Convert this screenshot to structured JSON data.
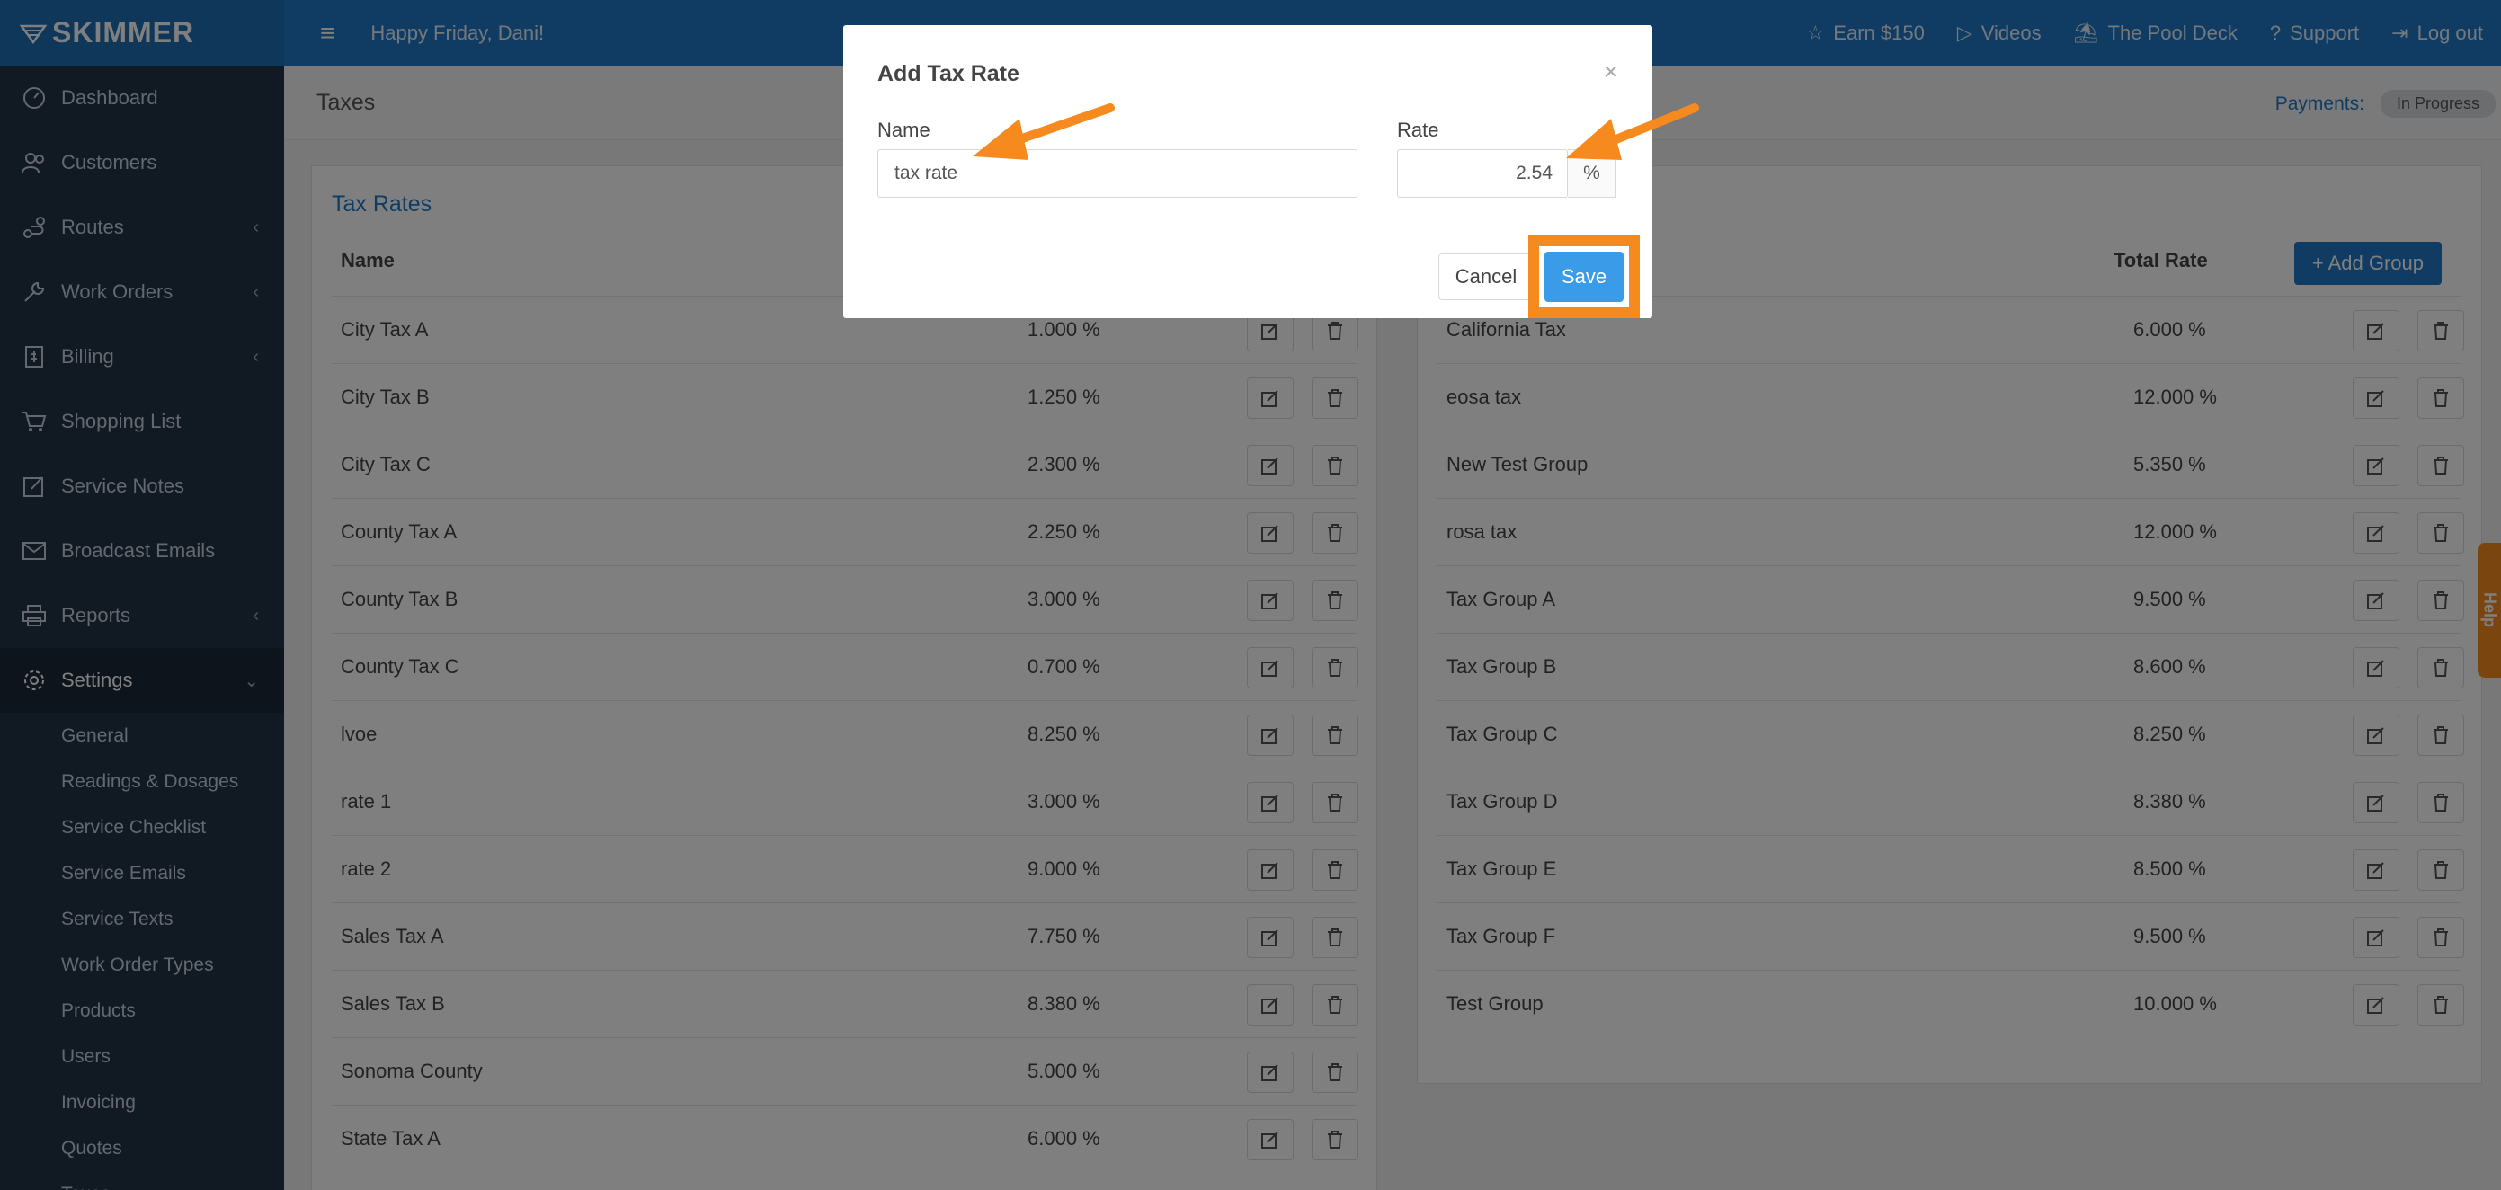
{
  "app": {
    "logo": "SKIMMER"
  },
  "topbar": {
    "greeting": "Happy Friday, Dani!",
    "links": [
      {
        "label": "Earn $150",
        "icon": "star-icon"
      },
      {
        "label": "Videos",
        "icon": "play-icon"
      },
      {
        "label": "The Pool Deck",
        "icon": "pool-icon"
      },
      {
        "label": "Support",
        "icon": "question-icon"
      },
      {
        "label": "Log out",
        "icon": "logout-icon"
      }
    ]
  },
  "sidebar": {
    "items": [
      {
        "label": "Dashboard",
        "icon": "dashboard-icon"
      },
      {
        "label": "Customers",
        "icon": "customers-icon"
      },
      {
        "label": "Routes",
        "icon": "routes-icon"
      },
      {
        "label": "Work Orders",
        "icon": "wrench-icon"
      },
      {
        "label": "Billing",
        "icon": "billing-icon"
      },
      {
        "label": "Shopping List",
        "icon": "cart-icon"
      },
      {
        "label": "Service Notes",
        "icon": "notes-icon"
      },
      {
        "label": "Broadcast Emails",
        "icon": "mail-icon"
      },
      {
        "label": "Reports",
        "icon": "printer-icon"
      },
      {
        "label": "Settings",
        "icon": "gear-icon"
      }
    ],
    "settings_sub": [
      "General",
      "Readings & Dosages",
      "Service Checklist",
      "Service Emails",
      "Service Texts",
      "Work Order Types",
      "Products",
      "Users",
      "Invoicing",
      "Quotes",
      "Taxes"
    ]
  },
  "page": {
    "title": "Taxes",
    "payments_label": "Payments:",
    "payments_status": "In Progress"
  },
  "tax_rates": {
    "title": "Tax Rates",
    "col_name": "Name",
    "rows": [
      {
        "name": "City Tax A",
        "rate": "1.000 %"
      },
      {
        "name": "City Tax B",
        "rate": "1.250 %"
      },
      {
        "name": "City Tax C",
        "rate": "2.300 %"
      },
      {
        "name": "County Tax A",
        "rate": "2.250 %"
      },
      {
        "name": "County Tax B",
        "rate": "3.000 %"
      },
      {
        "name": "County Tax C",
        "rate": "0.700 %"
      },
      {
        "name": "lvoe",
        "rate": "8.250 %"
      },
      {
        "name": "rate 1",
        "rate": "3.000 %"
      },
      {
        "name": "rate 2",
        "rate": "9.000 %"
      },
      {
        "name": "Sales Tax A",
        "rate": "7.750 %"
      },
      {
        "name": "Sales Tax B",
        "rate": "8.380 %"
      },
      {
        "name": "Sonoma County",
        "rate": "5.000 %"
      },
      {
        "name": "State Tax A",
        "rate": "6.000 %"
      }
    ]
  },
  "tax_groups": {
    "col_total": "Total Rate",
    "add_label": "+ Add Group",
    "rows": [
      {
        "name": "California Tax",
        "rate": "6.000 %"
      },
      {
        "name": "eosa tax",
        "rate": "12.000 %"
      },
      {
        "name": "New Test Group",
        "rate": "5.350 %"
      },
      {
        "name": "rosa tax",
        "rate": "12.000 %"
      },
      {
        "name": "Tax Group A",
        "rate": "9.500 %"
      },
      {
        "name": "Tax Group B",
        "rate": "8.600 %"
      },
      {
        "name": "Tax Group C",
        "rate": "8.250 %"
      },
      {
        "name": "Tax Group D",
        "rate": "8.380 %"
      },
      {
        "name": "Tax Group E",
        "rate": "8.500 %"
      },
      {
        "name": "Tax Group F",
        "rate": "9.500 %"
      },
      {
        "name": "Test Group",
        "rate": "10.000 %"
      }
    ]
  },
  "modal": {
    "title": "Add Tax Rate",
    "close": "×",
    "name_label": "Name",
    "name_value": "tax rate",
    "rate_label": "Rate",
    "rate_value": "2.54",
    "rate_unit": "%",
    "cancel": "Cancel",
    "save": "Save"
  },
  "help_tab": "Help",
  "colors": {
    "accent": "#2079c7",
    "highlight": "#f68a1e",
    "sidebar": "#233246"
  }
}
